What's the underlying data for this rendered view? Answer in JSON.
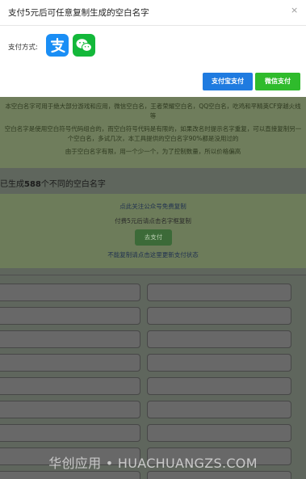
{
  "modal": {
    "title": "支付5元后可任意复制生成的空白名字",
    "close": "×",
    "pay_method_label": "支付方式:",
    "alipay_button": "支付宝支付",
    "wechat_button": "微信支付"
  },
  "background": {
    "desc_1": "本空白名字可用于绝大部分游戏和应用，微信空白名，王者荣耀空白名，QQ空白名，吃鸡和平精英CF穿越火线等",
    "desc_2": "空白名字是使用空白符号代码组合的，而空白符号代码是有限的，如果改名时提示名字重复，可以直接复制另一个空白名，多试几次，本工具提供的空白名字90%都是没用过的",
    "desc_3": "由于空白名字有限，用一个少一个，为了控制数量，所以价格偏高",
    "count_prefix": "已生成",
    "count_number": "588",
    "count_suffix": "个不同的空白名字",
    "follow_link": "点此关注公众号免费复制",
    "pay_hint": "付费5元后请点击名字框复制",
    "pay_button": "去支付",
    "status_link": "不能复制请点击这里更新支付状态"
  },
  "watermark": "华创应用 • HUACHUANGZS.COM"
}
